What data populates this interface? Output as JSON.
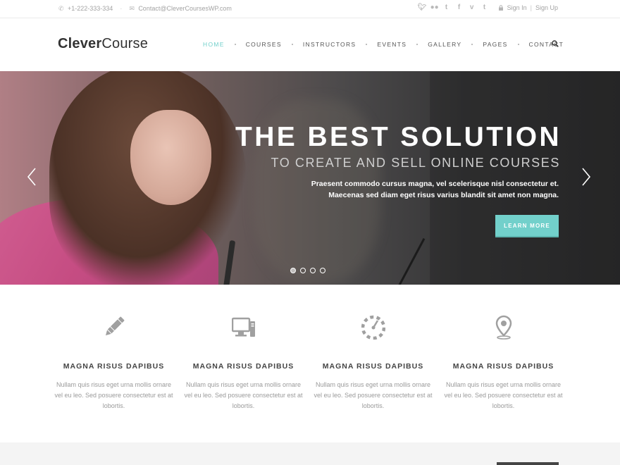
{
  "topbar": {
    "phone": "+1-222-333-334",
    "email": "Contact@CleverCoursesWP.com",
    "social_icons": [
      "twitter-icon",
      "flickr-icon",
      "tumblr-icon",
      "facebook-icon",
      "vimeo-icon",
      "tumblr-icon"
    ],
    "sign_in": "Sign In",
    "sign_up": "Sign Up"
  },
  "header": {
    "logo_bold": "Clever",
    "logo_light": "Course",
    "nav": [
      "HOME",
      "COURSES",
      "INSTRUCTORS",
      "EVENTS",
      "GALLERY",
      "PAGES",
      "CONTACT"
    ],
    "active_nav": "HOME"
  },
  "hero": {
    "title": "THE BEST SOLUTION",
    "subtitle": "TO CREATE AND SELL ONLINE COURSES",
    "desc_line1": "Praesent commodo cursus magna, vel scelerisque nisl consectetur et.",
    "desc_line2": "Maecenas sed diam eget risus varius blandit sit amet non magna.",
    "cta": "LEARN MORE",
    "slides": 4,
    "active_slide": 1
  },
  "features": [
    {
      "icon": "pencil-icon",
      "title": "MAGNA RISUS DAPIBUS",
      "text": "Nullam quis risus eget urna mollis ornare vel eu leo. Sed posuere consectetur est at lobortis."
    },
    {
      "icon": "computer-icon",
      "title": "MAGNA RISUS DAPIBUS",
      "text": "Nullam quis risus eget urna mollis ornare vel eu leo. Sed posuere consectetur est at lobortis."
    },
    {
      "icon": "dashboard-icon",
      "title": "MAGNA RISUS DAPIBUS",
      "text": "Nullam quis risus eget urna mollis ornare vel eu leo. Sed posuere consectetur est at lobortis."
    },
    {
      "icon": "map-pin-icon",
      "title": "MAGNA RISUS DAPIBUS",
      "text": "Nullam quis risus eget urna mollis ornare vel eu leo. Sed posuere consectetur est at lobortis."
    }
  ],
  "colors": {
    "accent": "#72d0cb",
    "text_dark": "#444444",
    "text_muted": "#9a9a9a"
  }
}
